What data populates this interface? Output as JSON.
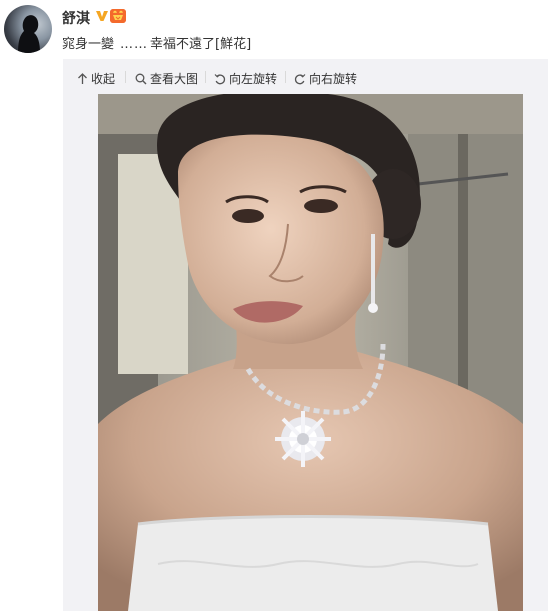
{
  "user": {
    "name": "舒淇",
    "avatar_icon": "avatar",
    "verified_icon": "verified-v-icon",
    "vip_icon": "vip-badge-icon",
    "accent_verified": "#f5a623",
    "accent_vip": "#f46a2c"
  },
  "post": {
    "text_main": "窕身一變",
    "ellipsis": "……",
    "text_end": "幸福不遠了[鮮花]"
  },
  "toolbar": {
    "collapse_label": "收起",
    "view_large_label": "查看大图",
    "rotate_left_label": "向左旋转",
    "rotate_right_label": "向右旋转"
  },
  "photo": {
    "description_icon": "selfie-photo",
    "subject": "woman-portrait"
  }
}
